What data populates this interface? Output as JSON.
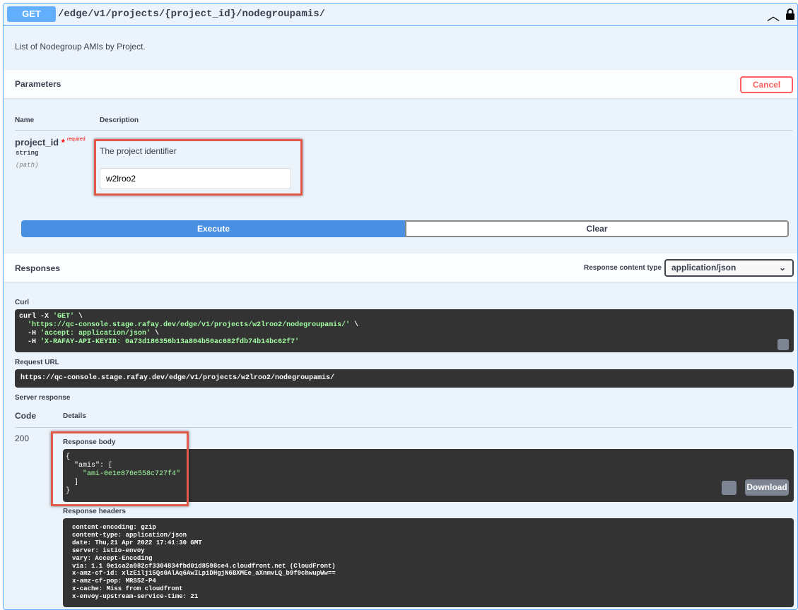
{
  "summary": {
    "method": "GET",
    "path": "/edge/v1/projects/{project_id}/nodegroupamis/",
    "collapse_icon": "chevron-up-icon",
    "lock_icon": "lock-icon"
  },
  "description": "List of Nodegroup AMIs by Project.",
  "parameters": {
    "title": "Parameters",
    "cancel_label": "Cancel",
    "col_name": "Name",
    "col_description": "Description",
    "items": [
      {
        "name": "project_id",
        "star": "*",
        "required": "required",
        "type": "string",
        "in": "(path)",
        "description": "The project identifier",
        "value": "w2lroo2"
      }
    ]
  },
  "actions": {
    "execute_label": "Execute",
    "clear_label": "Clear"
  },
  "responses": {
    "title": "Responses",
    "content_type_label": "Response content type",
    "content_type_value": "application/json",
    "curl_label": "Curl",
    "curl": {
      "line1": "curl -X ",
      "line1_str": "'GET'",
      "line1_end": " \\",
      "line2_str": "'https://qc-console.stage.rafay.dev/edge/v1/projects/w2lroo2/nodegroupamis/'",
      "line2_end": " \\",
      "line3": "  -H ",
      "line3_str": "'accept: application/json'",
      "line3_end": " \\",
      "line4": "  -H ",
      "line4_str": "'X-RAFAY-API-KEYID: 0a73d186356b13a804b50ac682fdb74b14bc62f7'"
    },
    "request_url_label": "Request URL",
    "request_url": "https://qc-console.stage.rafay.dev/edge/v1/projects/w2lroo2/nodegroupamis/",
    "server_response_label": "Server response",
    "code_col": "Code",
    "details_col": "Details",
    "status_code": "200",
    "body_label": "Response body",
    "body": {
      "l1": "{",
      "l2_key": "  \"amis\": [",
      "l3_str": "\"ami-0e1e876e558c727f4\"",
      "l4": "  ]",
      "l5": "}"
    },
    "download_label": "Download",
    "headers_label": "Response headers",
    "headers": [
      "content-encoding: gzip",
      "content-type: application/json",
      "date: Thu,21 Apr 2022 17:41:30 GMT",
      "server: istio-envoy",
      "vary: Accept-Encoding",
      "via: 1.1 9e1ca2a082cf3304834fbd01d8598ce4.cloudfront.net (CloudFront)",
      "x-amz-cf-id: xlzEilj15Qs0AlAq6AwILpiDHgjN6BXMEe_aXnmvLQ_b9f9chwupWw==",
      "x-amz-cf-pop: MRS52-P4",
      "x-cache: Miss from cloudfront",
      "x-envoy-upstream-service-time: 21"
    ],
    "copy_icon": "clipboard-icon"
  },
  "colors": {
    "get": "#61affe",
    "execute": "#4990e2",
    "cancel": "#ff6060",
    "highlight": "#e05a47",
    "code_bg": "#333333",
    "string": "#a2fca2"
  }
}
